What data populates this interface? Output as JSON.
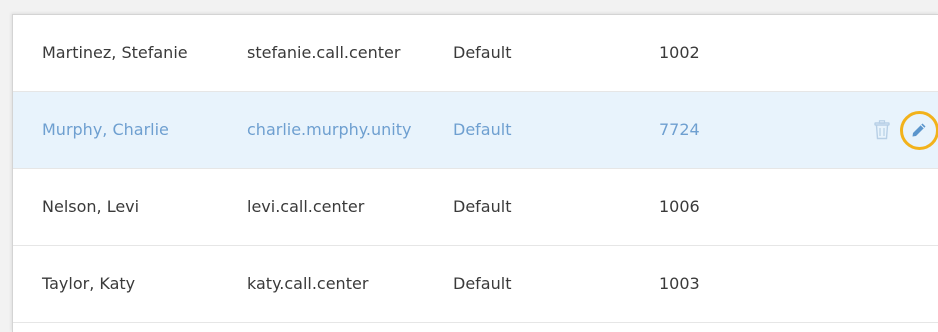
{
  "users": [
    {
      "name": "Martinez, Stefanie",
      "username": "stefanie.call.center",
      "group": "Default",
      "extension": "1002",
      "selected": false
    },
    {
      "name": "Murphy, Charlie",
      "username": "charlie.murphy.unity",
      "group": "Default",
      "extension": "7724",
      "selected": true
    },
    {
      "name": "Nelson, Levi",
      "username": "levi.call.center",
      "group": "Default",
      "extension": "1006",
      "selected": false
    },
    {
      "name": "Taylor, Katy",
      "username": "katy.call.center",
      "group": "Default",
      "extension": "1003",
      "selected": false
    }
  ],
  "actions": {
    "delete_icon": "trash-icon",
    "edit_icon": "pencil-icon"
  },
  "colors": {
    "selected_background": "#e8f3fc",
    "selected_text": "#6e9fd0",
    "highlight_ring": "#f2b21b",
    "text": "#3a3a3a"
  }
}
